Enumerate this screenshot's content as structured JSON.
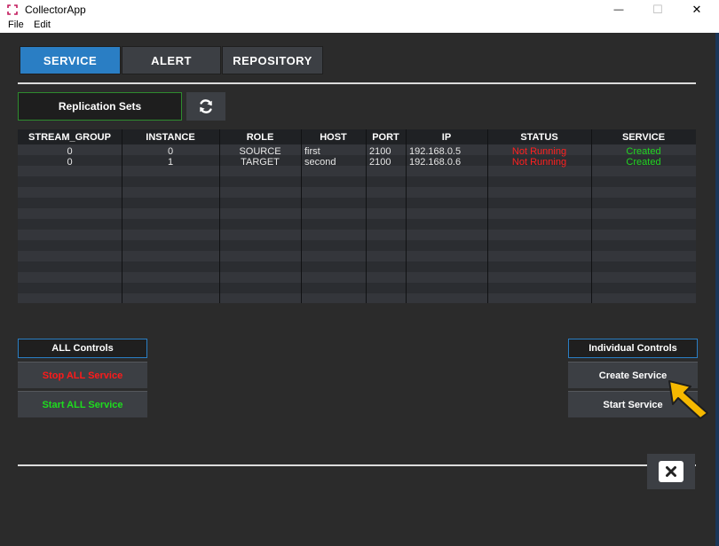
{
  "window": {
    "title": "CollectorApp",
    "minimize_glyph": "—",
    "maximize_glyph": "☐",
    "close_glyph": "✕",
    "menu": [
      "File",
      "Edit"
    ]
  },
  "tabs": [
    {
      "label": "SERVICE",
      "active": true
    },
    {
      "label": "ALERT",
      "active": false
    },
    {
      "label": "REPOSITORY",
      "active": false
    }
  ],
  "replication": {
    "label": "Replication Sets",
    "refresh_icon": "refresh-icon"
  },
  "table": {
    "columns": [
      "STREAM_GROUP",
      "INSTANCE",
      "ROLE",
      "HOST",
      "PORT",
      "IP",
      "STATUS",
      "SERVICE"
    ],
    "rows": [
      {
        "stream_group": "0",
        "instance": "0",
        "role": "SOURCE",
        "host": "first",
        "port": "2100",
        "ip": "192.168.0.5",
        "status": "Not Running",
        "service": "Created"
      },
      {
        "stream_group": "0",
        "instance": "1",
        "role": "TARGET",
        "host": "second",
        "port": "2100",
        "ip": "192.168.0.6",
        "status": "Not Running",
        "service": "Created"
      }
    ]
  },
  "all_controls": {
    "header": "ALL Controls",
    "stop": "Stop ALL Service",
    "start": "Start ALL Service"
  },
  "individual_controls": {
    "header": "Individual Controls",
    "create": "Create Service",
    "start": "Start Service"
  },
  "colors": {
    "accent": "#2a7ec4",
    "status_red": "#ff2020",
    "status_green": "#22d422",
    "pointer": "#f5b800"
  }
}
